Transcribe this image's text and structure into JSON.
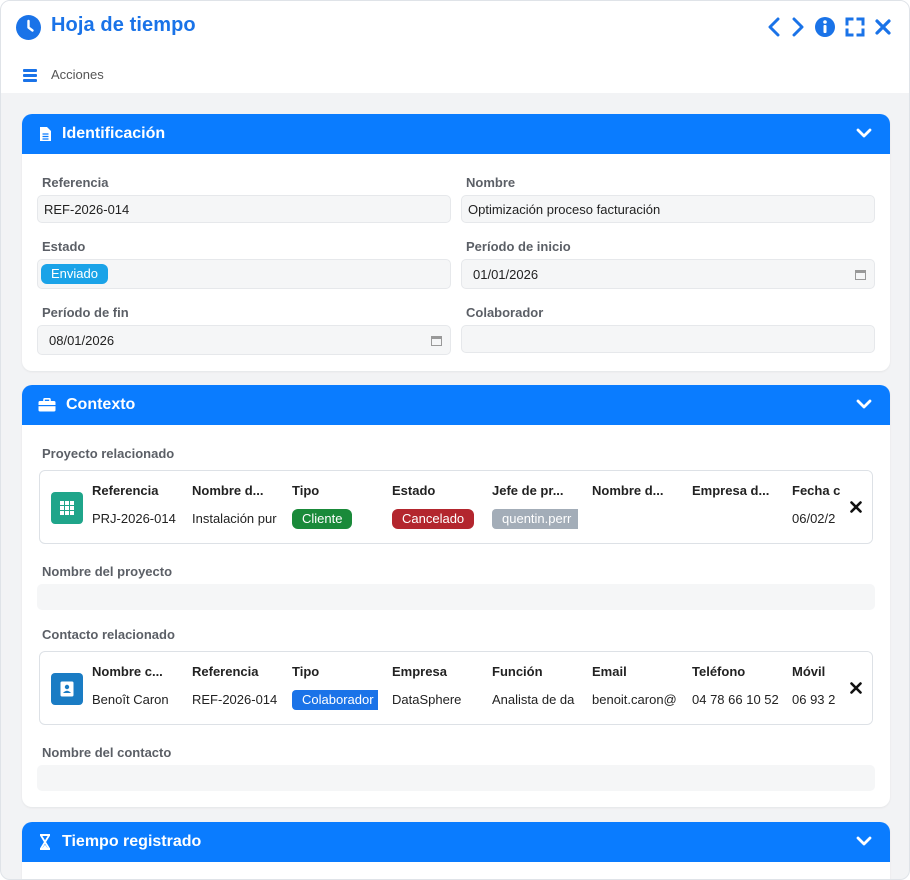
{
  "window": {
    "title": "Hoja de tiempo",
    "actions_label": "Acciones",
    "accent": "#1a73e8"
  },
  "identificacion": {
    "title": "Identificación",
    "referencia_label": "Referencia",
    "referencia_value": "REF-2026-014",
    "nombre_label": "Nombre",
    "nombre_value": "Optimización proceso facturación",
    "estado_label": "Estado",
    "estado_value": "Enviado",
    "periodo_inicio_label": "Período de inicio",
    "periodo_inicio_value": "01/01/2026",
    "periodo_fin_label": "Período de fin",
    "periodo_fin_value": "08/01/2026",
    "colaborador_label": "Colaborador",
    "colaborador_value": ""
  },
  "contexto": {
    "title": "Contexto",
    "proyecto_label": "Proyecto relacionado",
    "proyecto": {
      "headers": [
        "Referencia",
        "Nombre d...",
        "Tipo",
        "Estado",
        "Jefe de pr...",
        "Nombre d...",
        "Empresa d...",
        "Fecha c"
      ],
      "values": [
        "PRJ-2026-014",
        "Instalación pur",
        "Cliente",
        "Cancelado",
        "quentin.perr",
        "",
        "",
        "06/02/2"
      ]
    },
    "nombre_proyecto_label": "Nombre del proyecto",
    "contacto_label": "Contacto relacionado",
    "contacto": {
      "headers": [
        "Nombre c...",
        "Referencia",
        "Tipo",
        "Empresa",
        "Función",
        "Email",
        "Teléfono",
        "Móvil"
      ],
      "values": [
        "Benoît Caron",
        "REF-2026-014",
        "Colaborador",
        "DataSphere",
        "Analista de da",
        "benoit.caron@",
        "04 78 66 10 52",
        "06 93 2"
      ]
    },
    "nombre_contacto_label": "Nombre del contacto"
  },
  "tiempo": {
    "title": "Tiempo registrado"
  },
  "colors": {
    "header_blue": "#0a7cff",
    "estado_enviado": "#1aa3e8",
    "tipo_cliente": "#1a8a3a",
    "estado_cancelado": "#b3262e",
    "jefe_badge": "#a3adb8",
    "tipo_colaborador": "#1a73e8",
    "project_icon": "#1fa58a",
    "contact_icon": "#1a7cc4"
  },
  "icons": {
    "title": "clock-icon",
    "prev": "chevron-left-icon",
    "next": "chevron-right-icon",
    "info": "info-icon",
    "expand": "expand-icon",
    "close": "close-icon",
    "menu": "hamburger-icon",
    "identificacion": "document-icon",
    "contexto": "briefcase-icon",
    "tiempo": "hourglass-icon",
    "project": "grid-icon",
    "contact": "contact-card-icon"
  }
}
